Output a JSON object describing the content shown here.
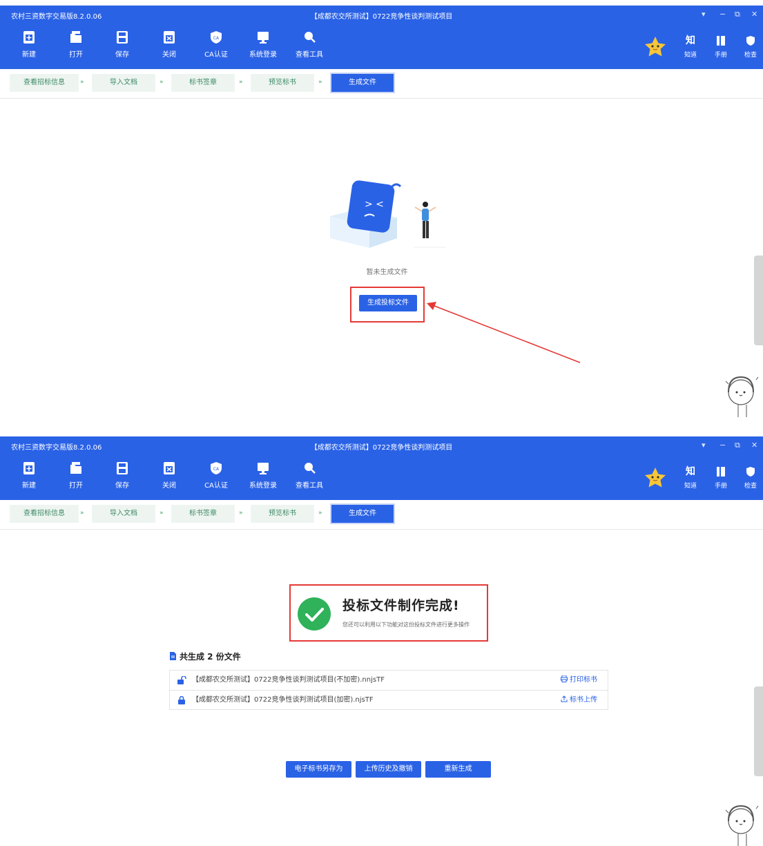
{
  "app_title": "农村三资数字交易版8.2.0.06",
  "project_title": "【成都农交所测试】0722竞争性谈判测试项目",
  "window_controls": [
    "▾",
    "−",
    "⧉",
    "✕"
  ],
  "toolbar": {
    "new": "新建",
    "open": "打开",
    "save": "保存",
    "close": "关闭",
    "ca": "CA认证",
    "login": "系统登录",
    "tools": "查看工具",
    "ca_badge": "CA"
  },
  "right_tools": {
    "zhidao_glyph": "知",
    "zhidao": "知道",
    "manual": "手册",
    "check": "检查"
  },
  "steps": [
    "查看招标信息",
    "导入文档",
    "标书签章",
    "预览标书",
    "生成文件"
  ],
  "step_arrow": "»",
  "before": {
    "empty_text": "暂未生成文件",
    "generate_button": "生成投标文件"
  },
  "after": {
    "success_title": "投标文件制作完成!",
    "success_subtitle": "您还可以利用以下功能对这份投标文件进行更多操作",
    "files_heading": "共生成 2 份文件",
    "files": [
      {
        "name": "【成都农交所测试】0722竞争性谈判测试项目(不加密).nnjsTF",
        "action": "打印标书",
        "locked": false
      },
      {
        "name": "【成都农交所测试】0722竞争性谈判测试项目(加密).njsTF",
        "action": "标书上传",
        "locked": true
      }
    ],
    "buttons": [
      "电子标书另存为",
      "上传历史及撤销",
      "重新生成"
    ]
  },
  "colors": {
    "primary": "#2a62e6",
    "highlight": "#e53935",
    "step_text": "#3f8a66",
    "success": "#2fb25a"
  }
}
